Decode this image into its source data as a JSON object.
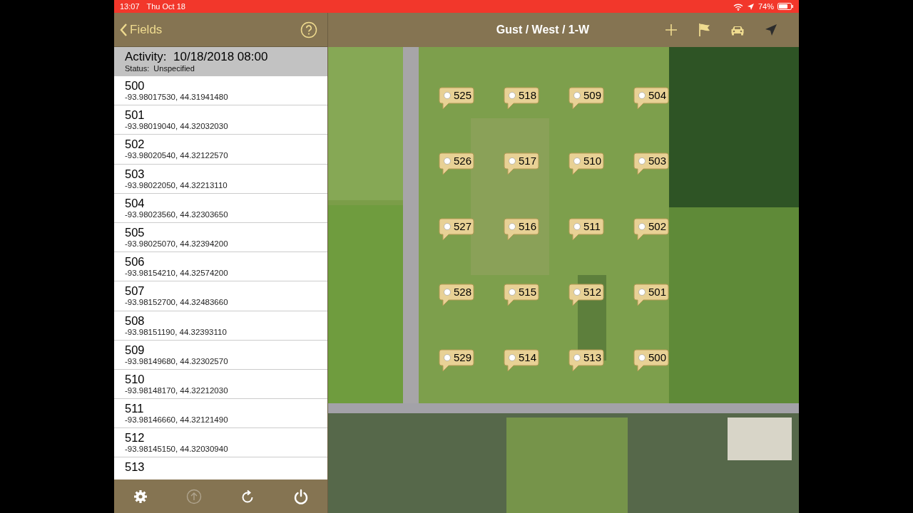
{
  "status_bar": {
    "time": "13:07",
    "date": "Thu Oct 18",
    "battery": "74%"
  },
  "sidebar": {
    "back_label": "Fields",
    "activity": "Activity:  10/18/2018 08:00",
    "status": "Status:  Unspecified",
    "items": [
      {
        "name": "500",
        "coords": "-93.98017530, 44.31941480"
      },
      {
        "name": "501",
        "coords": "-93.98019040, 44.32032030"
      },
      {
        "name": "502",
        "coords": "-93.98020540, 44.32122570"
      },
      {
        "name": "503",
        "coords": "-93.98022050, 44.32213110"
      },
      {
        "name": "504",
        "coords": "-93.98023560, 44.32303650"
      },
      {
        "name": "505",
        "coords": "-93.98025070, 44.32394200"
      },
      {
        "name": "506",
        "coords": "-93.98154210, 44.32574200"
      },
      {
        "name": "507",
        "coords": "-93.98152700, 44.32483660"
      },
      {
        "name": "508",
        "coords": "-93.98151190, 44.32393110"
      },
      {
        "name": "509",
        "coords": "-93.98149680, 44.32302570"
      },
      {
        "name": "510",
        "coords": "-93.98148170, 44.32212030"
      },
      {
        "name": "511",
        "coords": "-93.98146660, 44.32121490"
      },
      {
        "name": "512",
        "coords": "-93.98145150, 44.32030940"
      },
      {
        "name": "513"
      }
    ],
    "toolbar": [
      {
        "kind": "settings",
        "disabled": false
      },
      {
        "kind": "upload",
        "disabled": true
      },
      {
        "kind": "refresh",
        "disabled": false
      },
      {
        "kind": "power",
        "disabled": false
      }
    ]
  },
  "map": {
    "title": "Gust / West / 1-W",
    "pins": [
      "525",
      "518",
      "509",
      "504",
      "526",
      "517",
      "510",
      "503",
      "527",
      "516",
      "511",
      "502",
      "528",
      "515",
      "512",
      "501",
      "529",
      "514",
      "513",
      "500"
    ]
  }
}
